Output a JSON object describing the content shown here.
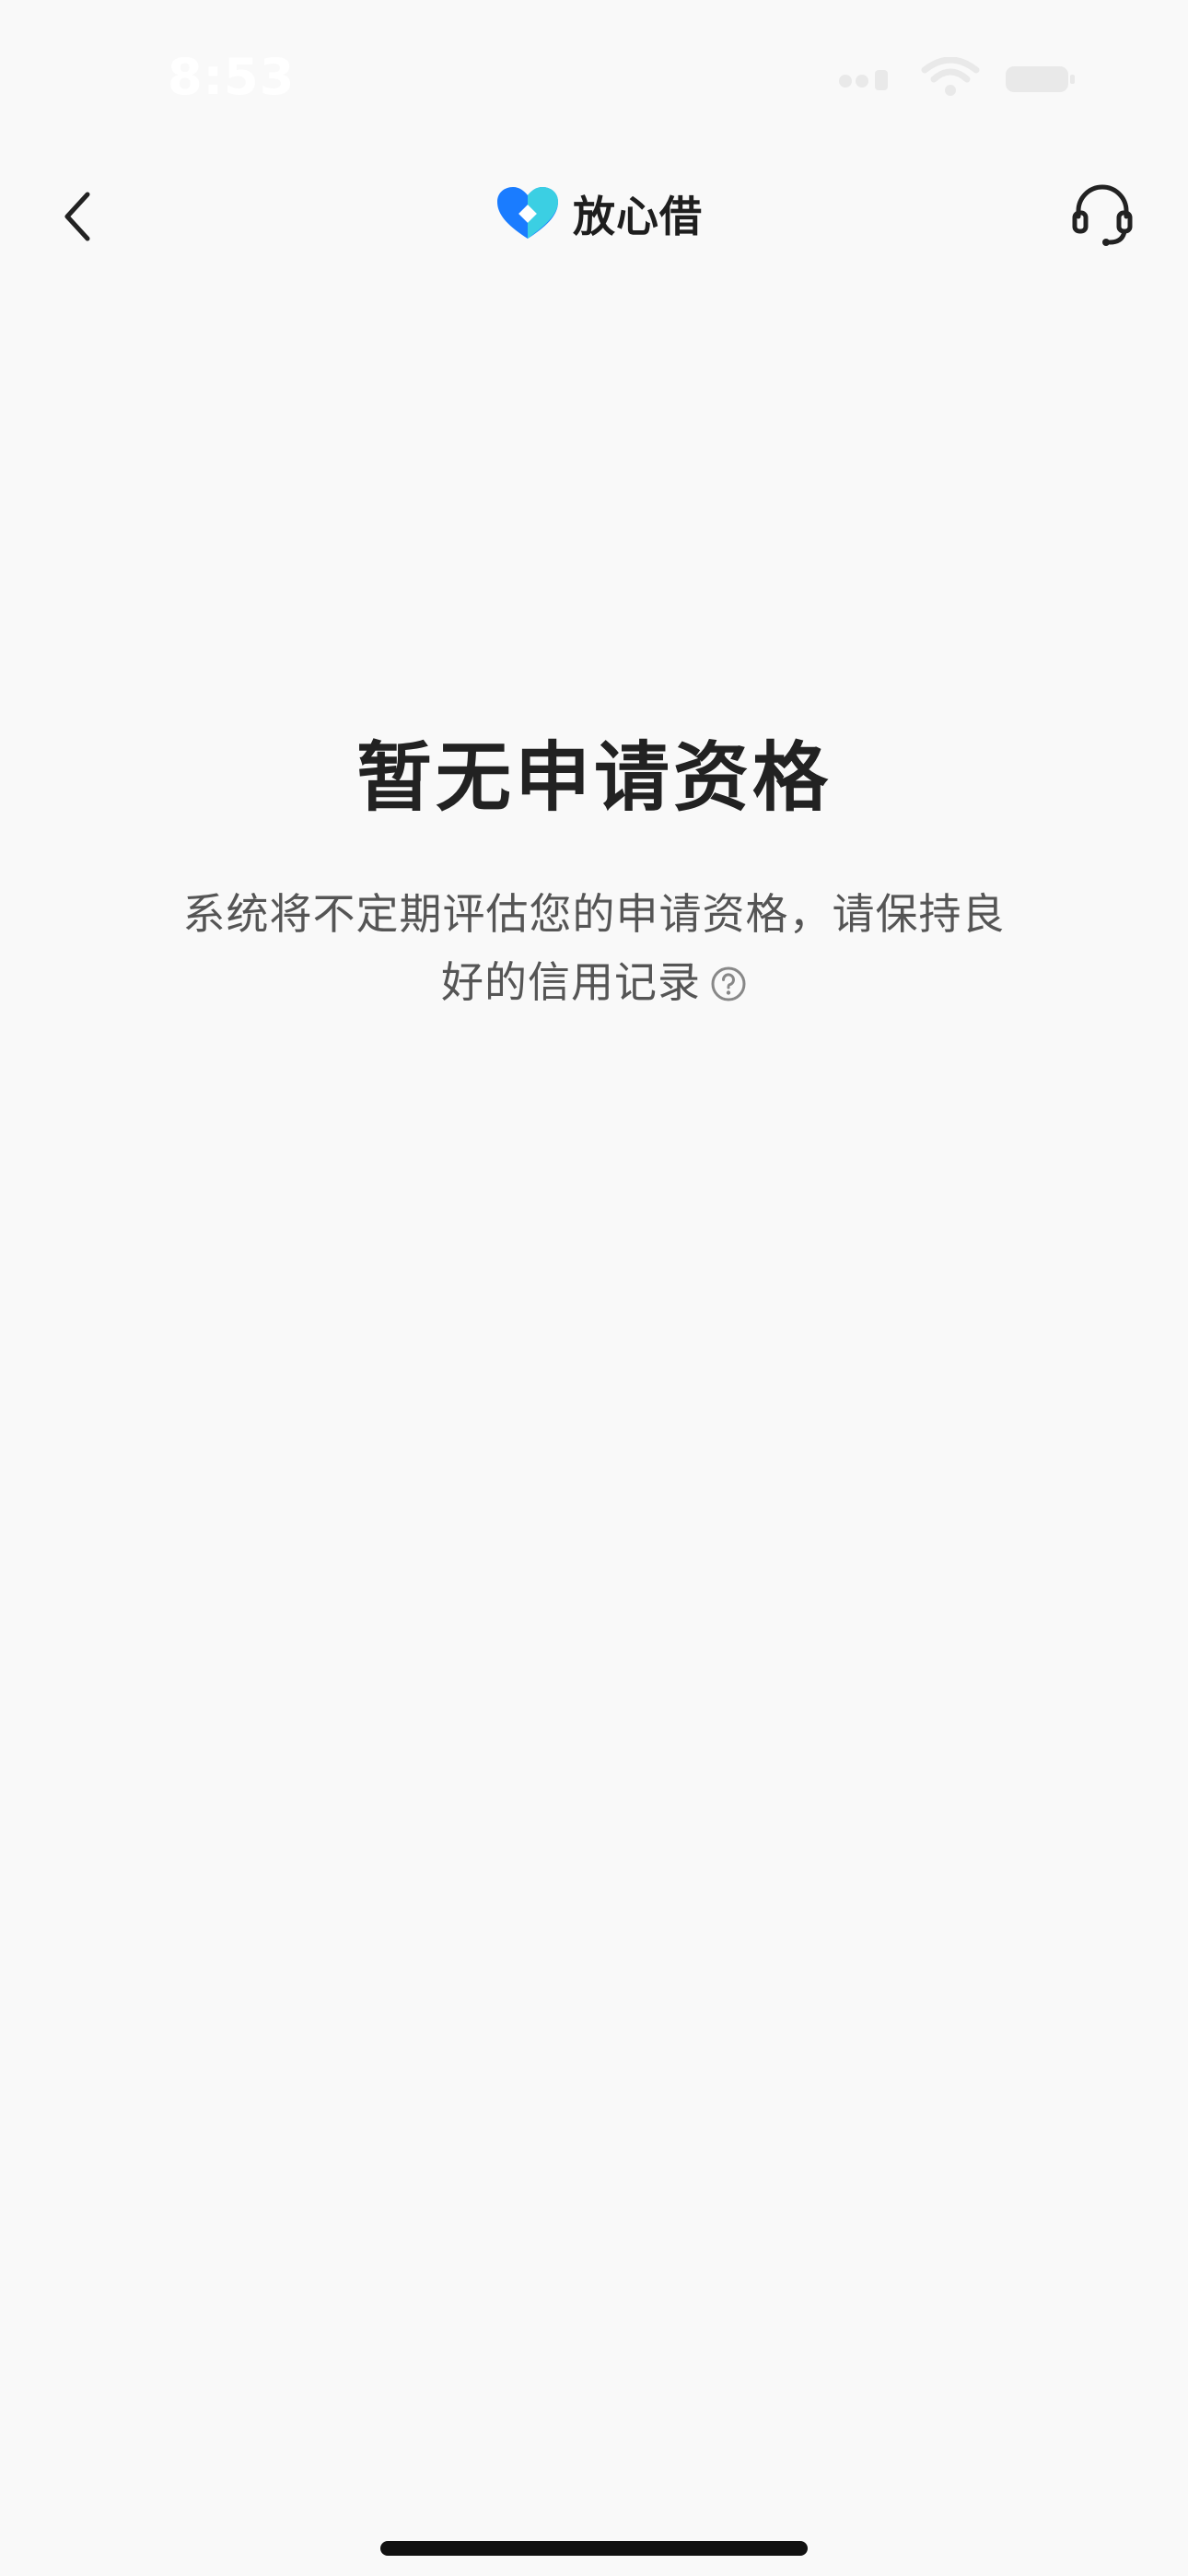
{
  "status_bar": {
    "time": "8:53"
  },
  "nav": {
    "brand_name": "放心借",
    "icons": {
      "back": "chevron-left-icon",
      "support": "headset-icon"
    }
  },
  "empty_state": {
    "title": "暂无申请资格",
    "description": "系统将不定期评估您的申请资格，请保持良好的信用记录",
    "help_icon": "question-circle-icon"
  },
  "colors": {
    "background": "#f9f9f9",
    "title": "#222222",
    "description": "#555555",
    "brand_blue": "#1a7cff",
    "brand_cyan": "#3fd8e0"
  }
}
